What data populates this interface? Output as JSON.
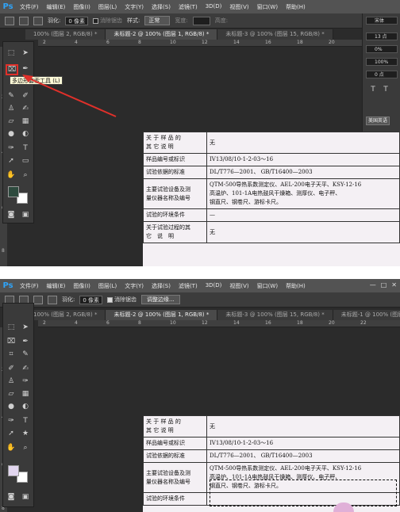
{
  "app": {
    "logo": "Ps"
  },
  "menu": [
    "文件(F)",
    "编辑(E)",
    "图像(I)",
    "图层(L)",
    "文字(Y)",
    "选择(S)",
    "滤镜(T)",
    "3D(D)",
    "视图(V)",
    "窗口(W)",
    "帮助(H)"
  ],
  "window_controls": [
    "—",
    "□",
    "✕"
  ],
  "panel1": {
    "options": {
      "feather_label": "羽化:",
      "feather_value": "0 像素",
      "antialias_label": "消除锯齿",
      "style_label": "样式:",
      "style_value": "正常",
      "width_label": "宽度:",
      "height_label": "高度:"
    },
    "tabs": [
      "100% (图层 2, RGB/8) *",
      "未标题-2 @ 100% (图层 1, RGB/8) *",
      "未标题-3 @ 100% (图层 15, RGB/8) *"
    ],
    "tooltip": "多边形套索工具 (L)",
    "right_panel": {
      "font": "宋体",
      "size": "13 点",
      "tracking": "0%",
      "scale": "100%",
      "baseline": "0 点",
      "lang": "美国英语"
    },
    "ruler_ticks": [
      "2",
      "4",
      "6",
      "8",
      "10",
      "12",
      "14",
      "16",
      "18",
      "20",
      "22"
    ],
    "vruler_ticks": [
      "0",
      "2",
      "4",
      "6",
      "8"
    ],
    "swatch_fg": "#2e4a3e"
  },
  "panel2": {
    "options": {
      "feather_label": "羽化:",
      "feather_value": "0 像素",
      "antialias_label": "消除锯齿",
      "refine_button": "调整边缘..."
    },
    "tabs": [
      "100% (图层 2, RGB/8) *",
      "未标题-2 @ 100% (图层 1, RGB/8) *",
      "未标题-3 @ 100% (图层 15, RGB/8) *",
      "未标题-1 @ 100% (图层 17, RGB/8) *"
    ],
    "ruler_ticks": [
      "2",
      "4",
      "6",
      "8",
      "10",
      "12",
      "14",
      "16",
      "18",
      "20",
      "22"
    ],
    "vruler_ticks": [
      "0",
      "2",
      "4",
      "6",
      "8"
    ],
    "swatch_fg": "#e2d6ef"
  },
  "doc": {
    "rows": [
      {
        "label": "关 于 样 品 的\n其 它 说 明",
        "value": "无"
      },
      {
        "label": "样品编号或标识",
        "value": "IV13/08/10-1-2-03～16"
      },
      {
        "label": "试验依据的标准",
        "value": "DL/T776—2001、 GB/T16400—2003"
      },
      {
        "label": "主要试验设备及测\n量仪器名称及编号",
        "value": "QTM-500导热系数测定仪、AEL-200电子天平、KSY-12-16\n高温炉、101-1A电热鼓风干燥箱、测厚仪、电子秤、\n钢直尺、钢卷尺、游标卡尺。"
      },
      {
        "label": "试验的环境条件",
        "value": "—"
      },
      {
        "label": "关于试验过程的其\n它　说　明",
        "value": "无"
      }
    ],
    "rows2_last_label": "试验的环境条件"
  }
}
